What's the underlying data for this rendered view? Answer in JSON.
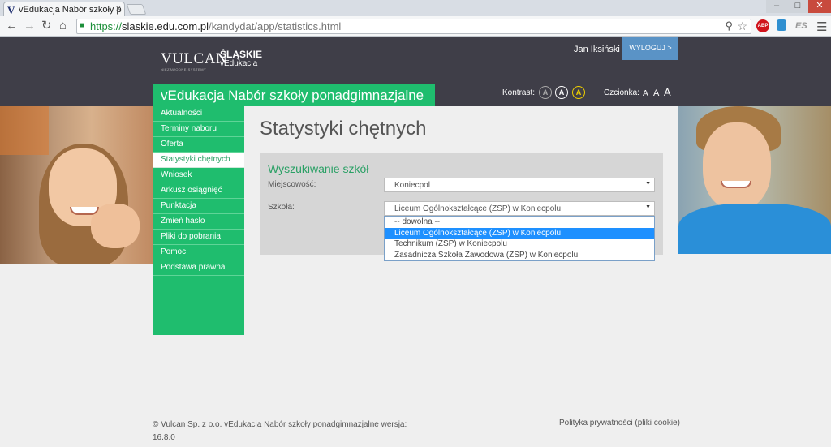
{
  "browser": {
    "tab_title": "vEdukacja Nabór szkoły p",
    "tab_favicon": "V",
    "tab_close": "×",
    "url_https": "https://",
    "url_host": "slaskie.edu.com.pl",
    "url_path": "/kandydat/app/statistics.html",
    "window_controls": {
      "minimize": "–",
      "maximize": "□",
      "close": "✕"
    },
    "extensions": {
      "abp": "ABP",
      "es": "ES"
    }
  },
  "header": {
    "brand": "VULCAN",
    "brand_small": "NIEZAWODNE SYSTEMY",
    "region_line1": "ŚLĄSKIE",
    "region_line2": "vEdukacja",
    "user_name": "Jan Iksiński",
    "logout_label": "WYLOGUJ >"
  },
  "titlebar": {
    "app_title": "vEdukacja Nabór szkoły ponadgimnazjalne",
    "contrast_label": "Kontrast:",
    "contrast_options": [
      "A",
      "A",
      "A"
    ],
    "font_label": "Czcionka:",
    "font_sizes": [
      "A",
      "A",
      "A"
    ]
  },
  "sidebar": {
    "items": [
      {
        "label": "Aktualności"
      },
      {
        "label": "Terminy naboru"
      },
      {
        "label": "Oferta"
      },
      {
        "label": "Statystyki chętnych"
      },
      {
        "label": "Wniosek"
      },
      {
        "label": "Arkusz osiągnięć"
      },
      {
        "label": "Punktacja"
      },
      {
        "label": "Zmień hasło"
      },
      {
        "label": "Pliki do pobrania"
      },
      {
        "label": "Pomoc"
      },
      {
        "label": "Podstawa prawna"
      }
    ],
    "active_index": 3
  },
  "main": {
    "page_title": "Statystyki chętnych",
    "search": {
      "title": "Wyszukiwanie szkół",
      "town_label": "Miejscowość:",
      "town_value": "Koniecpol",
      "school_label": "Szkoła:",
      "school_value": "Liceum Ogólnokształcące (ZSP) w Koniecpolu",
      "school_options": [
        "-- dowolna --",
        "Liceum Ogólnokształcące (ZSP) w Koniecpolu",
        "Technikum (ZSP) w Koniecpolu",
        "Zasadnicza Szkoła Zawodowa (ZSP) w Koniecpolu"
      ],
      "selected_option_index": 1
    }
  },
  "footer": {
    "copyright": "© Vulcan Sp. z o.o. vEdukacja Nabór szkoły ponadgimnazjalne wersja:",
    "version": "16.8.0",
    "privacy": "Polityka prywatności (pliki cookie)"
  },
  "colors": {
    "accent_green": "#1fbd6e",
    "header_dark": "#3f3e48",
    "logout_blue": "#5a93c6",
    "selection_blue": "#1e90ff"
  }
}
